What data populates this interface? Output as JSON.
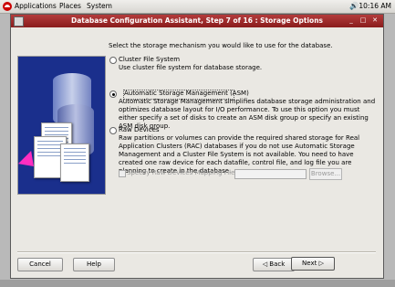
{
  "panel": {
    "menu_applications": "Applications",
    "menu_places": "Places",
    "menu_system": "System",
    "clock": "10:16 AM"
  },
  "window": {
    "title": "Database Configuration Assistant, Step 7 of 16 : Storage Options",
    "minimize": "_",
    "maximize": "□",
    "close": "✕"
  },
  "main": {
    "intro": "Select the storage mechanism you would like to use for the database.",
    "options": [
      {
        "label": "Cluster File System",
        "description": "Use cluster file system for database storage.",
        "selected": false
      },
      {
        "label": "Automatic Storage Management (ASM)",
        "description": "Automatic Storage Management simplifies database storage administration and optimizes database layout for I/O performance. To use this option you must either specify a set of disks to create an ASM disk group or specify an existing ASM disk group.",
        "selected": true
      },
      {
        "label": "Raw Devices",
        "description": "Raw partitions or volumes can provide the required shared storage for Real Application Clusters (RAC) databases if you do not use Automatic Storage Management and a Cluster File System is not available.  You need to have created one raw device for each datafile, control file, and log file you are planning to create in the database.",
        "selected": false
      }
    ],
    "mapping_checkbox_label": "Specify Raw Devices Mapping File",
    "mapping_value": "",
    "browse_label": "Browse..."
  },
  "footer": {
    "cancel": "Cancel",
    "help": "Help",
    "back": "Back",
    "next": "Next"
  }
}
